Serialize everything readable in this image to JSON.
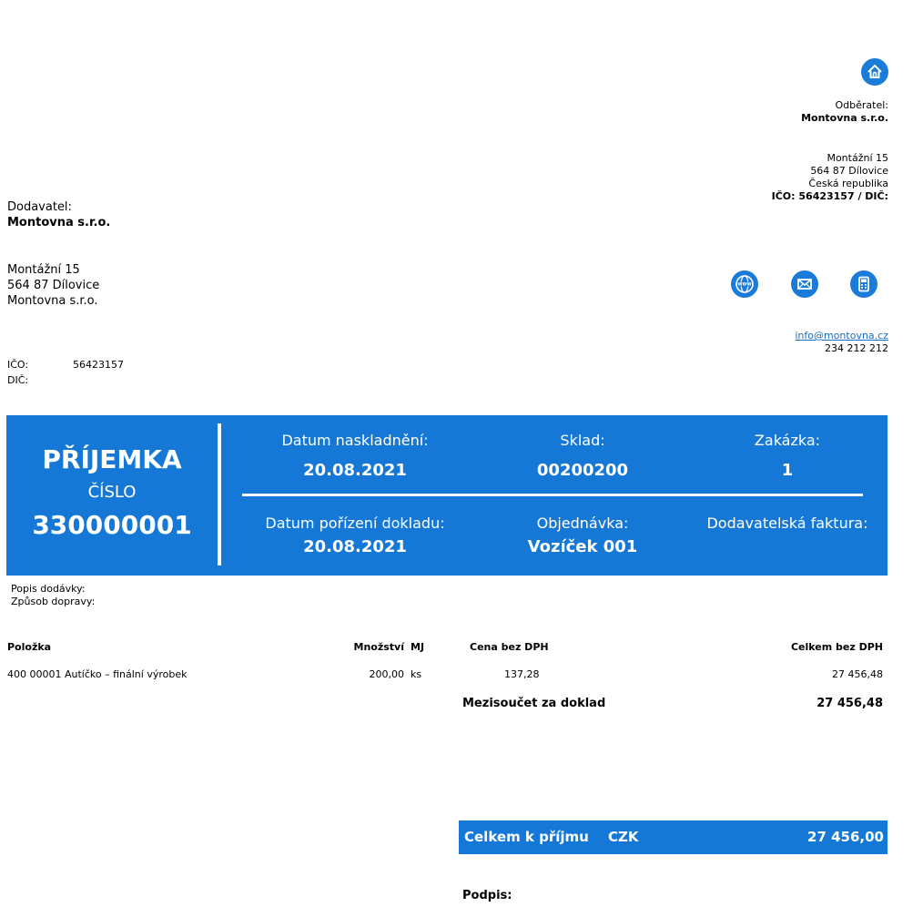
{
  "customer": {
    "label": "Odběratel:",
    "name": "Montovna s.r.o.",
    "street": "Montážní 15",
    "city": "564 87 Dílovice",
    "country": "Česká republika",
    "ids": "IČO: 56423157 / DIČ:"
  },
  "supplier": {
    "label": "Dodavatel:",
    "name": "Montovna s.r.o.",
    "street": "Montážní 15",
    "city": "564 87 Dílovice",
    "line3": "Montovna s.r.o.",
    "ico_label": "IČO:",
    "ico_value": "56423157",
    "dic_label": "DIČ:"
  },
  "contact": {
    "email": "info@montovna.cz",
    "phone": "234 212 212",
    "icons": [
      "home-icon",
      "globe-icon",
      "mail-icon",
      "phone-icon"
    ]
  },
  "banner": {
    "doc_title": "PŘÍJEMKA",
    "number_label": "ČÍSLO",
    "number": "330000001",
    "stock_date_label": "Datum naskladnění:",
    "stock_date": "20.08.2021",
    "warehouse_label": "Sklad:",
    "warehouse": "00200200",
    "job_label": "Zakázka:",
    "job": "1",
    "doc_date_label": "Datum pořízení dokladu:",
    "doc_date": "20.08.2021",
    "order_label": "Objednávka:",
    "order": "Vozíček 001",
    "invoice_label": "Dodavatelská faktura:",
    "invoice": ""
  },
  "delivery": {
    "description_label": "Popis dodávky:",
    "transport_label": "Způsob dopravy:"
  },
  "table": {
    "headers": {
      "item": "Položka",
      "qty": "Množství",
      "unit": "MJ",
      "price": "Cena bez DPH",
      "total": "Celkem bez DPH"
    },
    "rows": [
      {
        "item": "400 00001 Autíčko – finální výrobek",
        "qty": "200,00",
        "unit": "ks",
        "price": "137,28",
        "total": "27 456,48"
      }
    ],
    "subtotal_label": "Mezisoučet za doklad",
    "subtotal": "27 456,48"
  },
  "totals": {
    "label": "Celkem k příjmu",
    "currency": "CZK",
    "value": "27 456,00"
  },
  "signature_label": "Podpis:",
  "colors": {
    "accent": "#1578d6",
    "icon": "#1b7bd8",
    "link": "#1a6dc4"
  }
}
